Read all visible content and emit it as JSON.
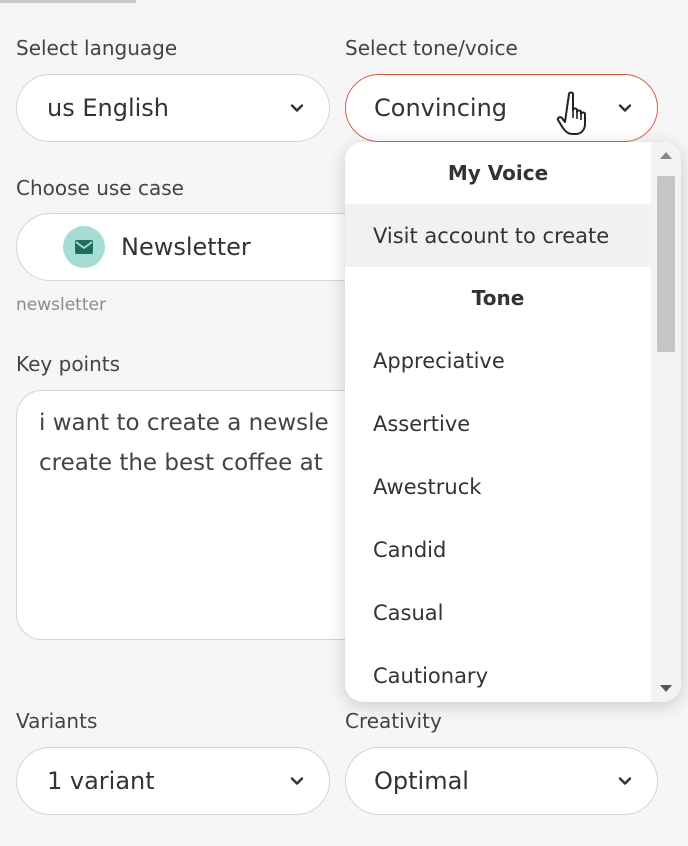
{
  "language": {
    "label": "Select language",
    "value": "us English"
  },
  "tone": {
    "label": "Select tone/voice",
    "value": "Convincing"
  },
  "use_case": {
    "label": "Choose use case",
    "value": "Newsletter",
    "hint": "newsletter"
  },
  "key_points": {
    "label": "Key points",
    "value": "i want to create a newsle\ncreate the best coffee at"
  },
  "variants": {
    "label": "Variants",
    "value": "1 variant"
  },
  "creativity": {
    "label": "Creativity",
    "value": "Optimal"
  },
  "tone_dropdown": {
    "my_voice_header": "My Voice",
    "my_voice_item": "Visit account to create",
    "tone_header": "Tone",
    "tones": [
      "Appreciative",
      "Assertive",
      "Awestruck",
      "Candid",
      "Casual",
      "Cautionary"
    ]
  },
  "colors": {
    "accent": "#d35b3f",
    "icon_bg": "#a7ddd4",
    "icon_fg": "#1f6b5e"
  },
  "icons": [
    "chevron-down-icon",
    "envelope-icon",
    "hand-pointer-cursor"
  ]
}
